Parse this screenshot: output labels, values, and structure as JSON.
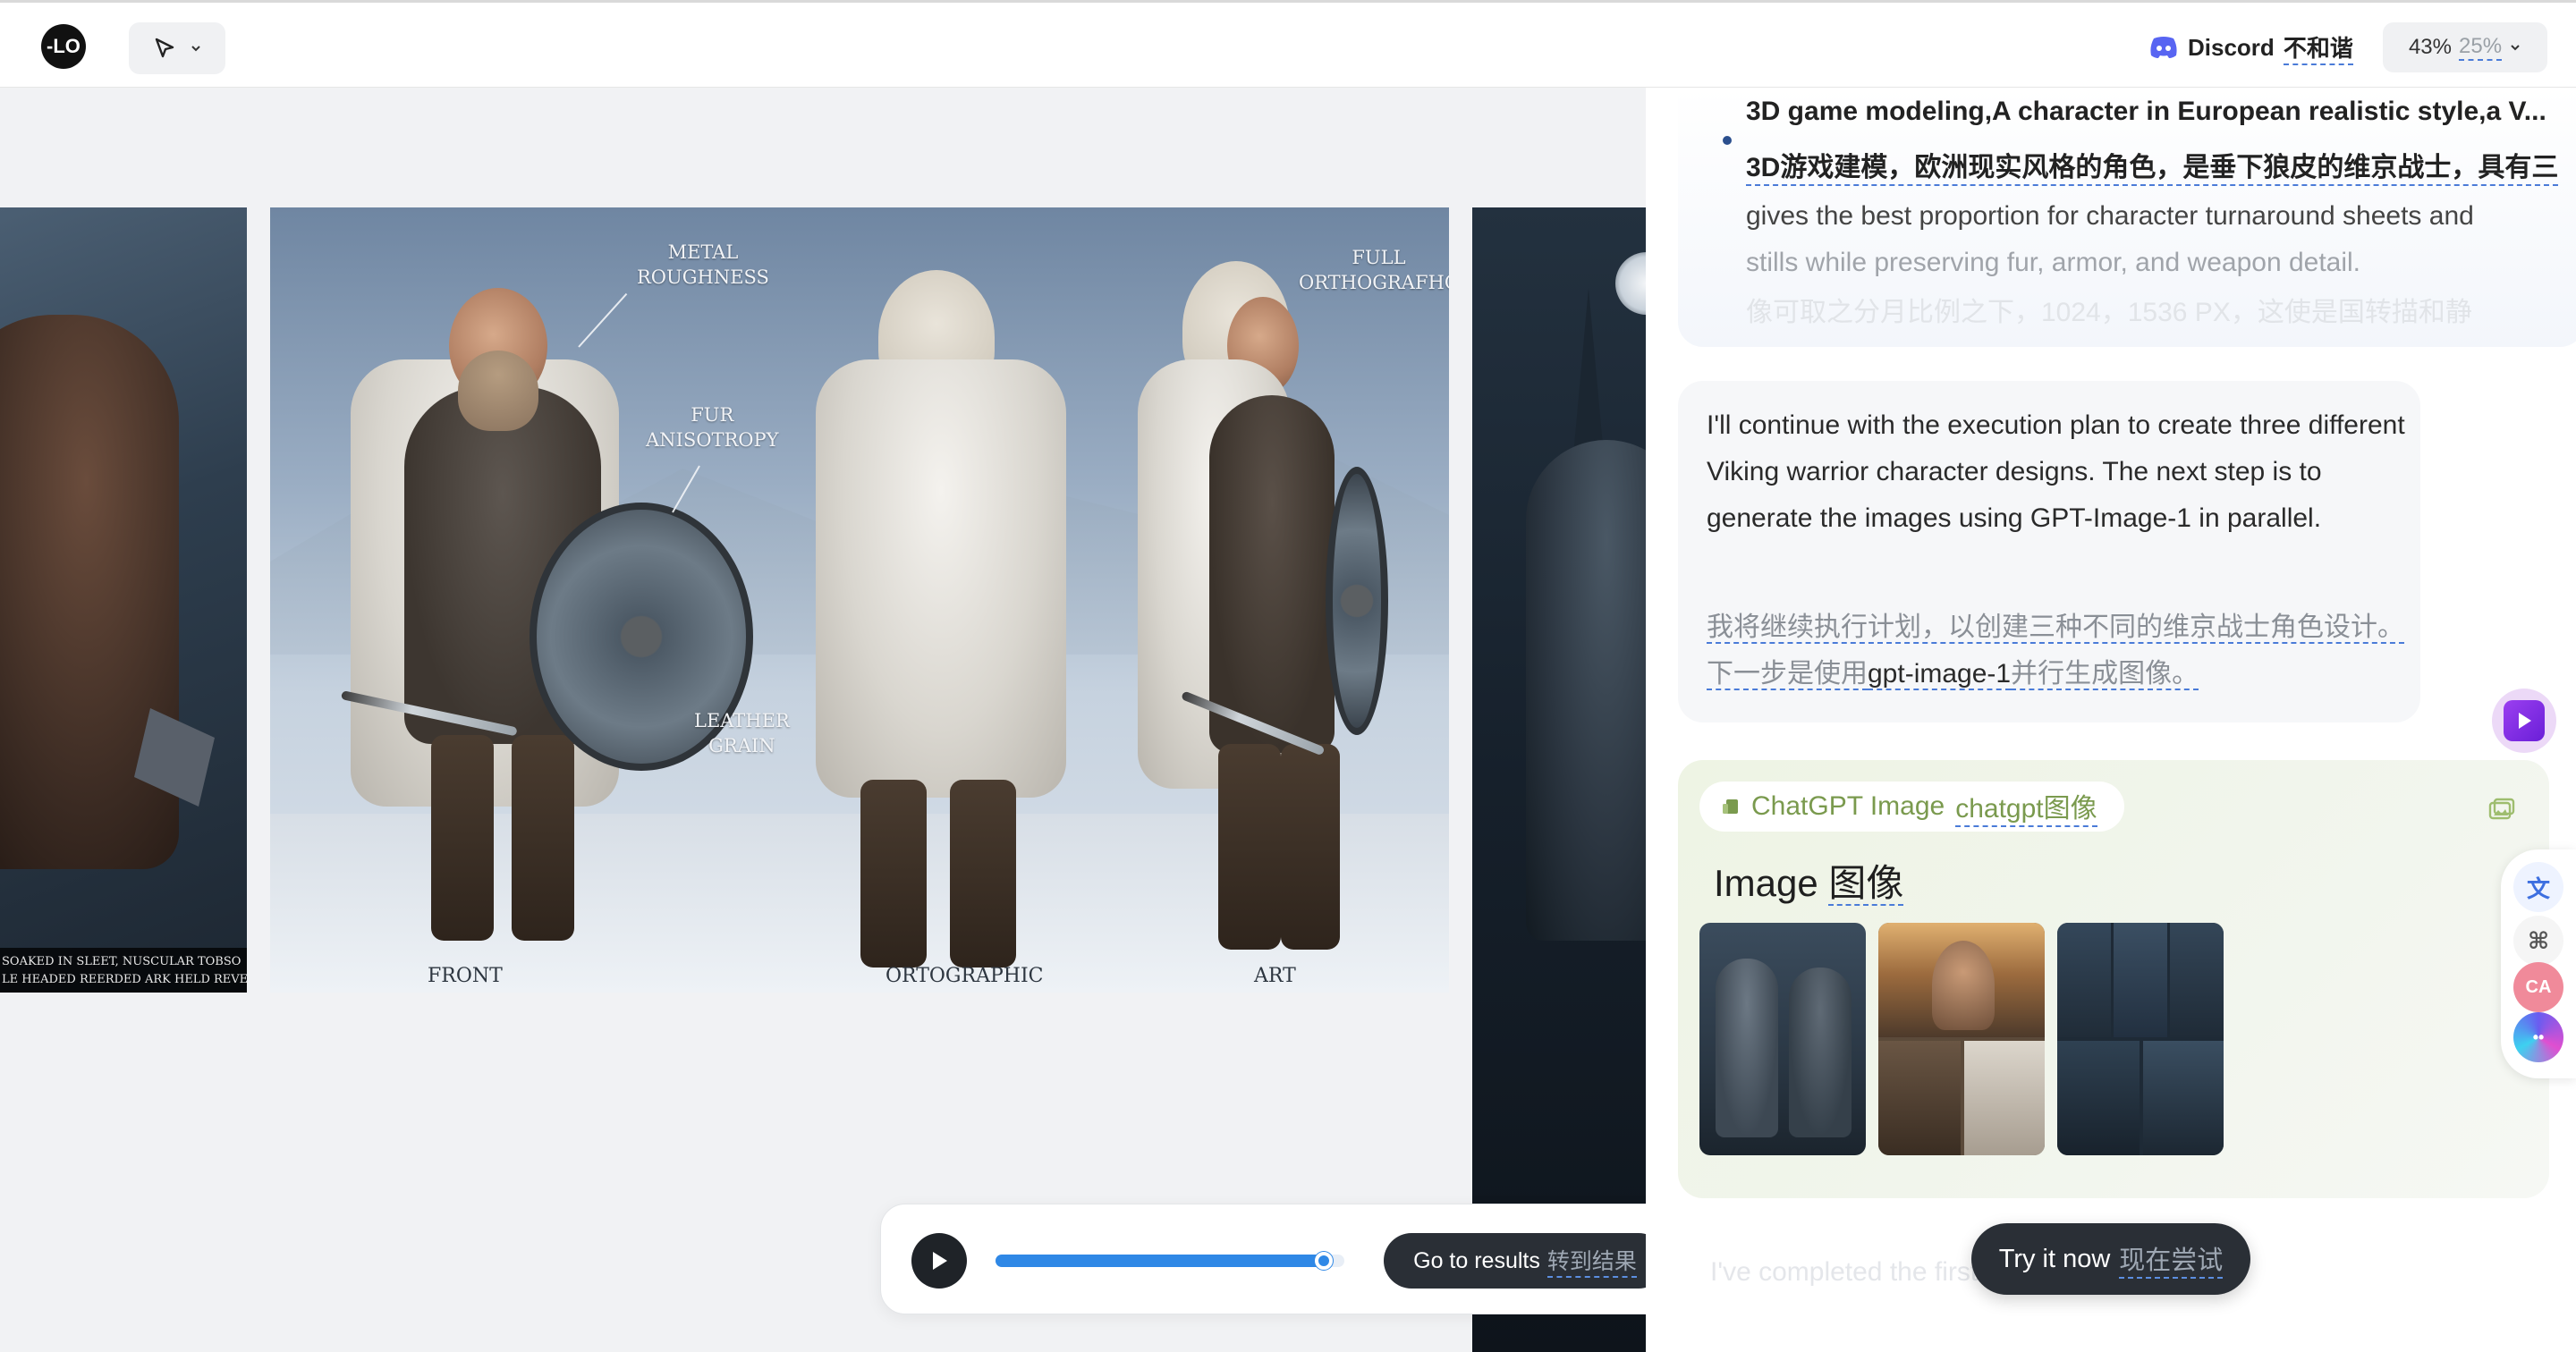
{
  "topbar": {
    "logo_text": "-LO",
    "tool_icon": "cursor-arrow-icon",
    "discord_label": "Discord",
    "discord_cn": "不和谐",
    "usage_a": "43%",
    "usage_b": "25%"
  },
  "canvas": {
    "left_caption_line1": "SOAKED IN SLEET, NUSCULAR TOBSO",
    "left_caption_line2": "LE HEADED REERDED ARK HELD REVE+",
    "callouts": {
      "metal_1": "METAL",
      "metal_2": "ROUGHNESS",
      "fur_1": "FUR",
      "fur_2": "ANISOTROPY",
      "leather_1": "LEATHER",
      "leather_2": "GRAIN",
      "full_1": "FULL",
      "full_2": "ORTHOGRAFHC"
    },
    "views": {
      "front": "FRONT",
      "ortho": "ORTOGRAPHIC",
      "art": "ART"
    }
  },
  "player": {
    "progress": 0.94,
    "results_label": "Go to results",
    "results_cn": "转到结果"
  },
  "chat": {
    "top": {
      "title": "3D game modeling,A character in European realistic style,a V...",
      "title_cn": "3D游戏建模，欧洲现实风格的角色，是垂下狼皮的维京战士，具有三",
      "body_line1": "gives the best proportion for character turnaround sheets and",
      "body_line2": "stills while preserving fur, armor, and weapon detail.",
      "fade_line": "像可取之分月比例之下，1024，1536 PX，这使是国转描和静"
    },
    "assistant": {
      "text_en": "I'll continue with the execution plan to create three different Viking warrior character designs. The next step is to generate the images using GPT-Image-1 in parallel.",
      "text_cn_a": "我将继续执行计划，以创建三种不同的维京战士角色设计。下一步是使用",
      "text_cn_b": "gpt-image-1",
      "text_cn_c": "并行生成图像。"
    },
    "tool": {
      "chip_label": "ChatGPT Image",
      "chip_cn": "chatgpt图像",
      "heading": "Image",
      "heading_cn": "图像"
    },
    "ghost_line": "I've completed the first of three images...",
    "try_label": "Try it now",
    "try_cn": "现在尝试"
  },
  "widgets": {
    "translate": "文",
    "cmd": "⌘",
    "ca": "CA",
    "bot": "••"
  },
  "colors": {
    "accent_blue": "#2f88e6",
    "dark_button": "#2a2f36",
    "tool_green": "#7a9a4e",
    "discord_purple": "#5865f2"
  }
}
